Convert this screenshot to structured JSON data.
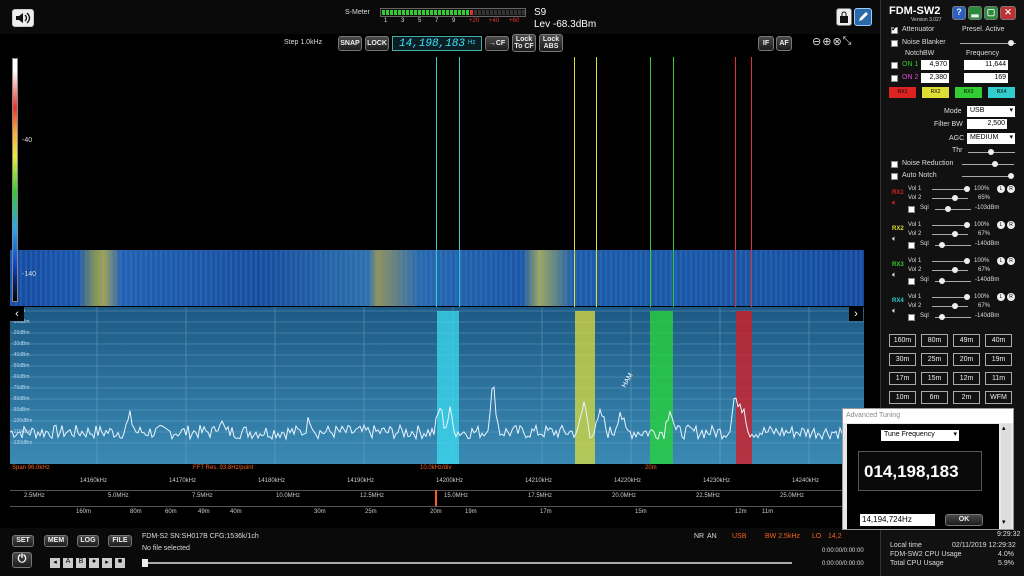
{
  "top": {
    "smeter_label": "S-Meter",
    "smeter_scale": [
      "1",
      "3",
      "5",
      "7",
      "9",
      "+20",
      "+40",
      "+60"
    ],
    "s_value": "S9",
    "level": "Lev -68.3dBm",
    "step": "Step 1.0kHz",
    "snap": "SNAP",
    "lock": "LOCK",
    "frequency": "14,198,183",
    "freq_unit": "Hz",
    "to_cf": "→CF",
    "lock_to_cf": "Lock\nTo CF",
    "lock_abs": "Lock\nABS",
    "if": "IF",
    "af": "AF"
  },
  "waterfall": {
    "label_40": "-40",
    "label_140": "-140"
  },
  "spectrum": {
    "db_labels": [
      "0dBm",
      "-10dBm",
      "-20dBm",
      "-30dBm",
      "-40dBm",
      "-50dBm",
      "-60dBm",
      "-70dBm",
      "-80dBm",
      "-90dBm",
      "-100dBm",
      "-110dBm",
      "-120dBm"
    ],
    "span": "Span 96.0kHz",
    "fft": "FFT Res. 93.8Hz/point",
    "div": "10.0kHz/div",
    "band_20m": "20m",
    "ham_label": "HAM",
    "freq_ticks": [
      "14160kHz",
      "14170kHz",
      "14180kHz",
      "14190kHz",
      "14200kHz",
      "14210kHz",
      "14220kHz",
      "14230kHz",
      "14240kHz"
    ],
    "mhz_ticks": [
      "2.5MHz",
      "5.0MHz",
      "7.5MHz",
      "10.0MHz",
      "12.5MHz",
      "15.0MHz",
      "17.5MHz",
      "20.0MHz",
      "22.5MHz",
      "25.0MHz"
    ],
    "meter_ticks": [
      "160m",
      "80m",
      "60m",
      "49m",
      "40m",
      "30m",
      "25m",
      "20m",
      "19m",
      "17m",
      "15m",
      "12m",
      "11m"
    ]
  },
  "bottom": {
    "set": "SET",
    "mem": "MEM",
    "log": "LOG",
    "file": "FILE",
    "device": "FDM-S2 SN:SH017B  CFG:1536k/1ch",
    "no_file": "No file selected",
    "nr": "NR",
    "an": "AN",
    "usb": "USB",
    "bw": "BW 2.5kHz",
    "lo": "LO",
    "lo_value": "14,2",
    "time1": "0:00:00/0:00:00",
    "time2": "0:00:00/0:00:00"
  },
  "panel": {
    "title": "FDM-SW2",
    "version": "Version 3.027",
    "attenuator": "Attenuator",
    "presel": "Presel. Active",
    "noise_blanker": "Noise Blanker",
    "notch": "Notch",
    "bw": "BW",
    "frequency": "Frequency",
    "on1": "ON 1",
    "on2": "ON 2",
    "bw1": "4,970",
    "bw2": "2,380",
    "f1": "11,644",
    "f2": "169",
    "rx_buttons": [
      "RX1",
      "RX2",
      "RX3",
      "RX4"
    ],
    "mode_label": "Mode",
    "mode": "USB",
    "filterbw_label": "Filter BW",
    "filterbw": "2,500",
    "agc_label": "AGC",
    "agc": "MEDIUM",
    "thr_label": "Thr",
    "noise_reduction": "Noise Reduction",
    "auto_notch": "Auto Notch",
    "rx": [
      {
        "name": "RX1",
        "vol1": "100%",
        "vol2": "65%",
        "sql": "-103dBm"
      },
      {
        "name": "RX2",
        "vol1": "100%",
        "vol2": "67%",
        "sql": "-140dBm"
      },
      {
        "name": "RX3",
        "vol1": "100%",
        "vol2": "67%",
        "sql": "-140dBm"
      },
      {
        "name": "RX4",
        "vol1": "100%",
        "vol2": "67%",
        "sql": "-140dBm"
      }
    ],
    "vol1": "Vol 1",
    "vol2": "Vol 2",
    "sql": "Sql",
    "bands": [
      "160m",
      "80m",
      "49m",
      "40m",
      "30m",
      "25m",
      "20m",
      "19m",
      "17m",
      "15m",
      "12m",
      "11m",
      "10m",
      "6m",
      "2m",
      "WFM"
    ],
    "clock": "9:29:32",
    "local_time_label": "Local time",
    "local_time": "02/11/2019 12:29:32",
    "cpu_label": "FDM-SW2 CPU Usage",
    "cpu": "4.0%",
    "total_cpu_label": "Total CPU Usage",
    "total_cpu": "5.9%"
  },
  "advanced": {
    "title": "Advanced Tuning",
    "mode": "Tune Frequency",
    "freq": "014,198,183",
    "input": "14,194,724Hz",
    "ok": "OK"
  }
}
